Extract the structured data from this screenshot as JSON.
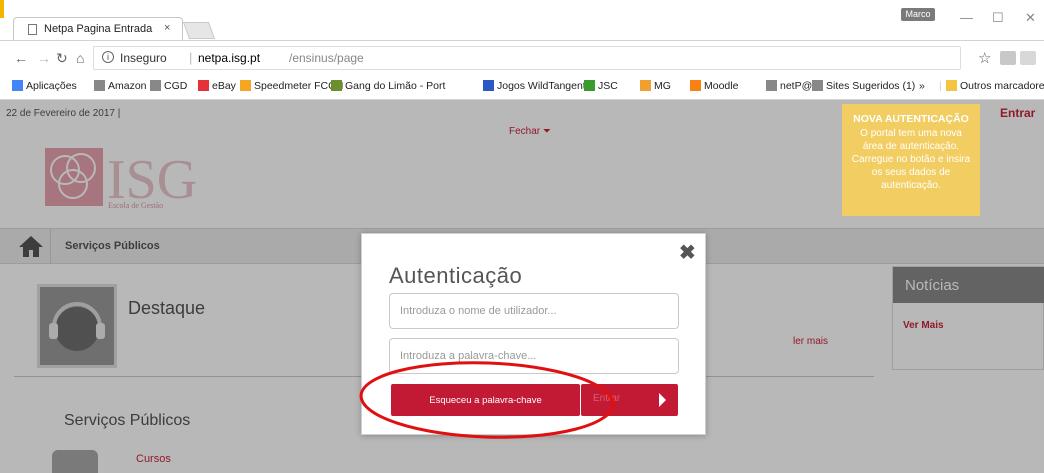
{
  "browser": {
    "tab_title": "Netpa Pagina Entrada",
    "tab_close": "×",
    "profile_label": "Marco",
    "security_label": "Inseguro",
    "url_host": "netpa.isg.pt",
    "url_path": "/ensinus/page",
    "info_glyph": "i",
    "window_controls": {
      "minimize": "—",
      "maximize": "☐",
      "close": "✕"
    }
  },
  "bookmarks": [
    {
      "label": "Aplicações",
      "icon": "apps-icon",
      "color": "#4285f4"
    },
    {
      "label": "Amazon",
      "icon": "page-icon",
      "color": "#888888"
    },
    {
      "label": "CGD",
      "icon": "page-icon",
      "color": "#888888"
    },
    {
      "label": "eBay",
      "icon": "ebay-icon",
      "color": "#e53238"
    },
    {
      "label": "Speedmeter FCCN",
      "icon": "speedmeter-icon",
      "color": "#f5a623"
    },
    {
      "label": "Gang do Limão - Port",
      "icon": "gang-icon",
      "color": "#6a8f2c"
    },
    {
      "label": "Jogos WildTangent",
      "icon": "wildtangent-icon",
      "color": "#2b59c3"
    },
    {
      "label": "JSC",
      "icon": "jsc-icon",
      "color": "#3a9b2e"
    },
    {
      "label": "MG",
      "icon": "mg-icon",
      "color": "#f0a030"
    },
    {
      "label": "Moodle",
      "icon": "moodle-icon",
      "color": "#f98012"
    },
    {
      "label": "netP@",
      "icon": "page-icon",
      "color": "#888888"
    },
    {
      "label": "Sites Sugeridos (1)",
      "icon": "page-icon",
      "color": "#888888"
    }
  ],
  "bookmarks_overflow": "»",
  "bookmarks_other": "Outros marcadores",
  "page": {
    "date": "22 de Fevereiro de 2017 |",
    "entrar_link": "Entrar",
    "fechar_link": "Fechar",
    "nav_item": "Serviços Públicos",
    "destaque": "Destaque",
    "ler_mais": "ler mais",
    "servicos_heading": "Serviços Públicos",
    "cursos": "Cursos",
    "noticias": "Notícias",
    "ver_mais": "Ver Mais",
    "logo_text": "ISG",
    "logo_sub": "Escola de Gestão"
  },
  "tooltip": {
    "title": "NOVA AUTENTICAÇÃO",
    "body": "O portal tem uma nova área de autenticação. Carregue no botão e insira os seus dados de autenticação."
  },
  "modal": {
    "title": "Autenticação",
    "close": "✖",
    "username_placeholder": "Introduza o nome de utilizador...",
    "password_placeholder": "Introduza a palavra-chave...",
    "forgot_button": "Esqueceu a palavra-chave",
    "enter_button": "Entrar"
  },
  "colors": {
    "accent": "#c21a35",
    "tooltip": "#f2cd62",
    "annotation": "#e01010"
  }
}
